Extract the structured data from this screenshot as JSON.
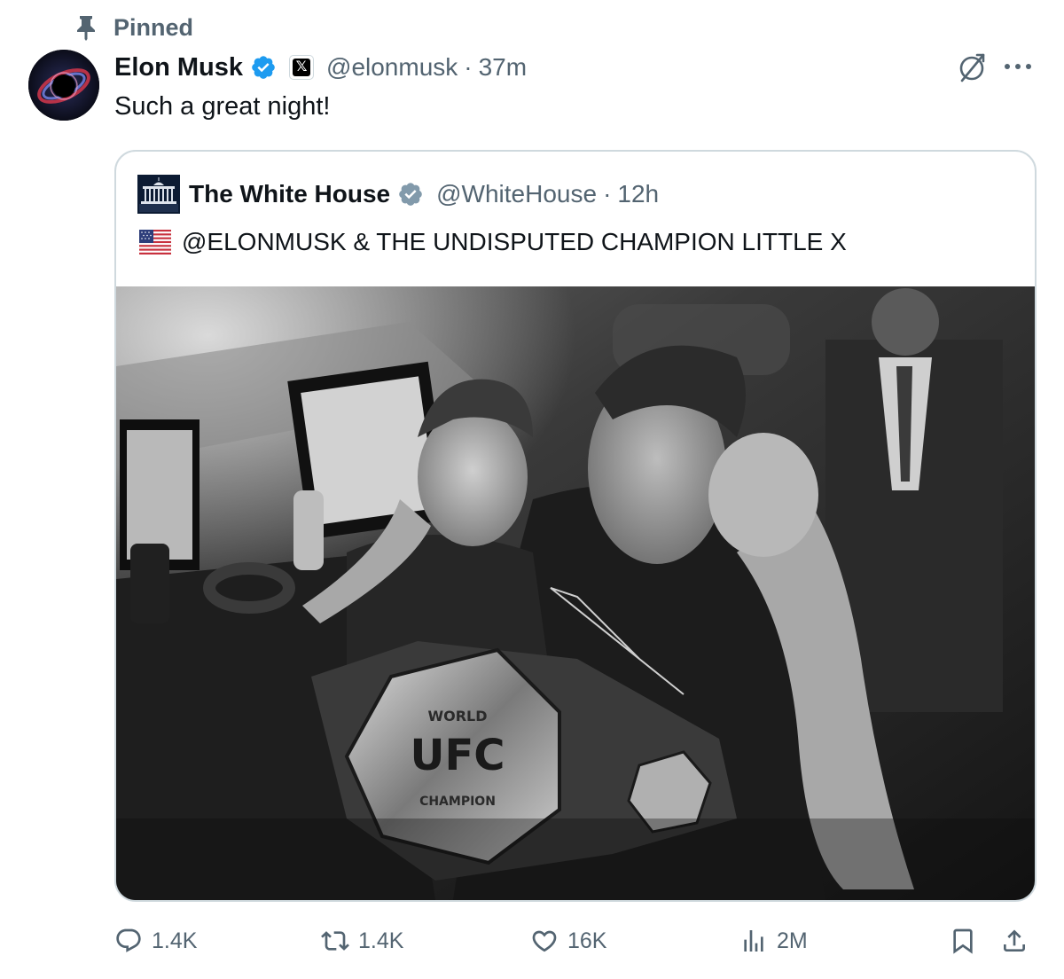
{
  "pinned": {
    "label": "Pinned",
    "icon": "pin-icon"
  },
  "post": {
    "author_name": "Elon Musk",
    "handle": "@elonmusk",
    "separator": "·",
    "timestamp": "37m",
    "affiliate_badge_glyph": "𝕏",
    "text": "Such a great night!",
    "verified_color": "#1d9bf0"
  },
  "quote": {
    "author_name": "The White House",
    "handle": "@WhiteHouse",
    "separator": "·",
    "timestamp": "12h",
    "text": "@ELONMUSK & THE UNDISPUTED CHAMPION LITTLE X",
    "flag_icon": "us-flag-icon",
    "gov_badge_color": "#829aab"
  },
  "actions": {
    "replies": "1.4K",
    "reposts": "1.4K",
    "likes": "16K",
    "views": "2M"
  },
  "photo": {
    "belt_lettering": [
      "WORLD",
      "UFC",
      "CHAMPION"
    ]
  },
  "colors": {
    "text_primary": "#0f1419",
    "text_secondary": "#536471",
    "border": "#cfd9de"
  }
}
